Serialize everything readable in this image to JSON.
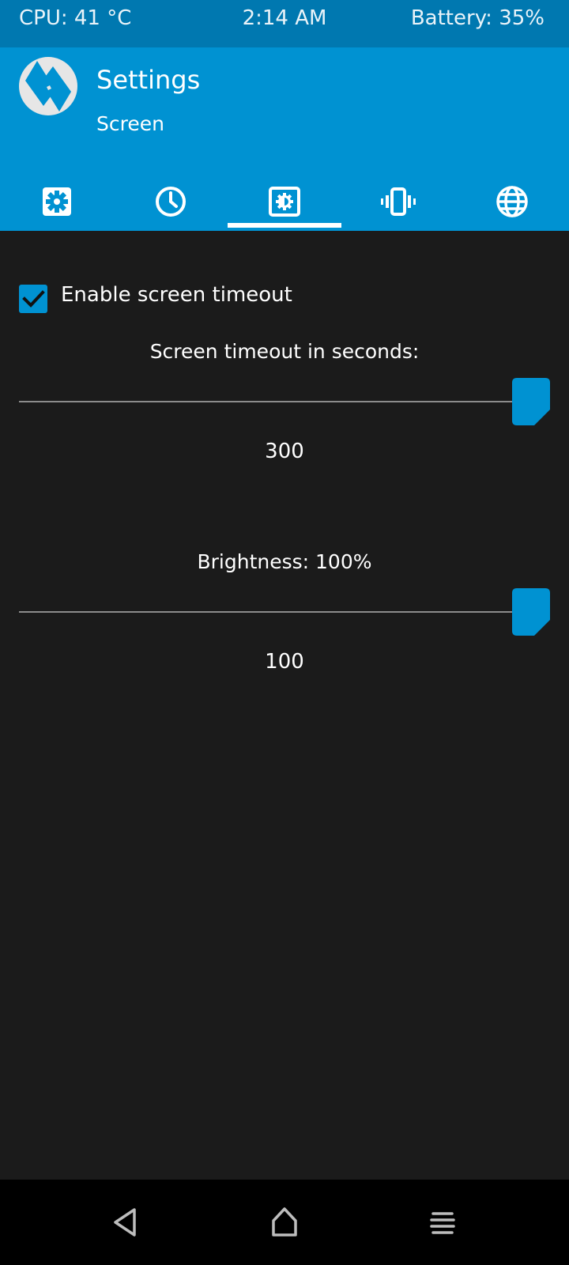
{
  "status_bar": {
    "cpu": "CPU: 41 °C",
    "time": "2:14 AM",
    "battery": "Battery: 35%"
  },
  "header": {
    "title": "Settings",
    "subtitle": "Screen",
    "tabs": [
      {
        "icon": "gear-icon"
      },
      {
        "icon": "clock-icon"
      },
      {
        "icon": "screen-brightness-icon",
        "selected": true
      },
      {
        "icon": "vibration-icon"
      },
      {
        "icon": "globe-icon"
      }
    ]
  },
  "screen": {
    "timeout_checkbox_label": "Enable screen timeout",
    "timeout_checked": true,
    "timeout_heading": "Screen timeout in seconds:",
    "timeout_value": "300",
    "timeout_fraction": 1.0,
    "brightness_heading": "Brightness: 100%",
    "brightness_value": "100",
    "brightness_fraction": 1.0
  },
  "nav": {
    "buttons": [
      "back-icon",
      "home-icon",
      "menu-icon"
    ]
  },
  "colors": {
    "accent": "#0092d2",
    "status_bar": "#0078b0",
    "background": "#1b1b1b"
  }
}
